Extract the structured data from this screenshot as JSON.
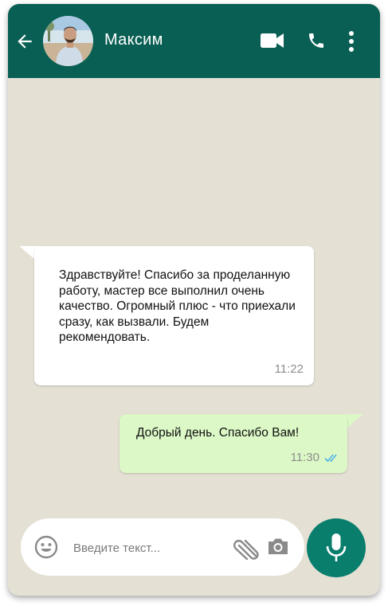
{
  "header": {
    "contact_name": "Максим",
    "icons": [
      "back-arrow-icon",
      "video-call-icon",
      "phone-icon",
      "more-vertical-icon"
    ]
  },
  "messages": [
    {
      "direction": "incoming",
      "text": "Здравствуйте! Спасибо за проделанную работу, мастер все выполнил очень качество. Огромный плюс - что приехали сразу, как вызвали. Будем рекомендовать.",
      "time": "11:22"
    },
    {
      "direction": "outgoing",
      "text": "Добрый день. Спасибо Вам!",
      "time": "11:30",
      "status": "read"
    }
  ],
  "composer": {
    "placeholder": "Введите текст...",
    "icons": [
      "emoji-icon",
      "attach-icon",
      "camera-icon",
      "mic-icon"
    ]
  },
  "colors": {
    "header": "#0a5f54",
    "chat_background": "#e4e0d4",
    "incoming_bubble": "#ffffff",
    "outgoing_bubble": "#dcf8c6",
    "mic_button": "#0a7e6d",
    "read_ticks": "#4fb3e8"
  }
}
